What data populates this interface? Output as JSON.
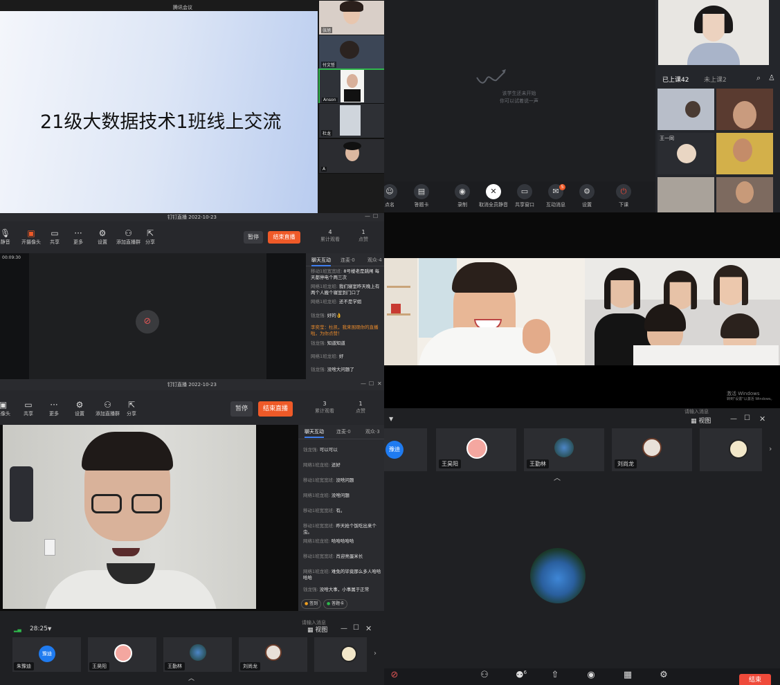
{
  "panel_a": {
    "meeting_label": "腾讯会议",
    "slide_title": "21级大数据技术1班线上交流",
    "thumbnails": [
      {
        "name": "张旭"
      },
      {
        "name": "付文哲"
      },
      {
        "name": "Anson"
      },
      {
        "name": "杜龙"
      },
      {
        "name": "A"
      }
    ]
  },
  "panel_b": {
    "empty_text_1": "该学生还未开始",
    "empty_text_2": "你可以试着说一声",
    "tabs": {
      "attended": "已上课42",
      "not_attended": "未上课2"
    },
    "student_names": [
      "王一同"
    ],
    "toolbar": [
      "点名",
      "答题卡",
      "录制",
      "取消全员静音",
      "共享窗口",
      "互动消息",
      "设置",
      "下课"
    ],
    "message_badge": "5"
  },
  "panel_c": {
    "title": "钉钉直播 2022-10-23",
    "tools": [
      "静音",
      "开摄像头",
      "共享",
      "更多",
      "设置",
      "添加直播群",
      "分享"
    ],
    "pause_label": "暂停",
    "end_label": "结束直播",
    "stats": [
      {
        "value": "4",
        "label": "累计观看"
      },
      {
        "value": "1",
        "label": "点赞"
      }
    ],
    "timer": "00:09:30",
    "chat_tabs": [
      "聊天互动",
      "连麦·0",
      "观众·4"
    ],
    "messages": [
      {
        "who": "移动1班宽宽班:",
        "text": "8号楼老是跳闸 每天都停电个两三次"
      },
      {
        "who": "网络1班龙班:",
        "text": "我们寝室昨天晚上有两个人搬个寝室到门口了"
      },
      {
        "who": "网络1班龙班:",
        "text": "还不是学姐"
      },
      {
        "who": "钱龙强:",
        "text": "好的👌"
      },
      {
        "who": "",
        "text": "李奕莹：杜凯，我来围观你的直播啦，为你点赞！",
        "sys": true
      },
      {
        "who": "钱龙强:",
        "text": "知道知道"
      },
      {
        "who": "网络1班龙班:",
        "text": "好"
      },
      {
        "who": "钱龙强:",
        "text": "没啥大问题了"
      }
    ]
  },
  "panel_d": {
    "title": "钉钉直播 2022-10-23",
    "tools": [
      "摄像头",
      "共享",
      "更多",
      "设置",
      "添加直播群",
      "分享"
    ],
    "pause_label": "暂停",
    "end_label": "结束直播",
    "stats": [
      {
        "value": "3",
        "label": "累计观看"
      },
      {
        "value": "1",
        "label": "点赞"
      }
    ],
    "chat_tabs": [
      "聊天互动",
      "连麦·0",
      "观众·3"
    ],
    "messages": [
      {
        "who": "钱龙强:",
        "text": "可以可以"
      },
      {
        "who": "网络1班龙班:",
        "text": "还好"
      },
      {
        "who": "移动1班宽宽班:",
        "text": "没啥问题"
      },
      {
        "who": "网络1班龙班:",
        "text": "没啥问题"
      },
      {
        "who": "移动1班宽宽班:",
        "text": "有。"
      },
      {
        "who": "移动1班宽宽班:",
        "text": "昨天抢个饭吃出来个虫。"
      },
      {
        "who": "网络1班龙班:",
        "text": "哈哈哈哈哈"
      },
      {
        "who": "移动1班宽宽班:",
        "text": "肖迎亮蛋米长"
      },
      {
        "who": "网络1班龙班:",
        "text": "难免的毕竟那么多人哈哈哈哈"
      },
      {
        "who": "钱龙强:",
        "text": "没啥大事，小事属于正常"
      }
    ],
    "actions": [
      "签到",
      "答题卡"
    ]
  },
  "panel_e": {
    "windows_activation_1": "激活 Windows",
    "windows_activation_2": "转到\"设置\"以激活 Windows。"
  },
  "panel_f": {
    "view_label": "视图",
    "hint": "请输入消息",
    "participants": [
      {
        "name": "豫迪"
      },
      {
        "name": "王昊阳"
      },
      {
        "name": "王勤林"
      },
      {
        "name": "刘尚龙"
      },
      {
        "name": ""
      }
    ],
    "bottom_badge": "6",
    "end_label": "结束"
  },
  "panel_g": {
    "timer": "28:25",
    "view_label": "视图",
    "hint": "请输入消息",
    "participants": [
      {
        "name": "朱豫迪",
        "avatar": "豫迪"
      },
      {
        "name": "王昊阳"
      },
      {
        "name": "王勤林"
      },
      {
        "name": "刘尚龙"
      },
      {
        "name": ""
      }
    ]
  },
  "colors": {
    "accent_orange": "#ef5a28",
    "accent_green": "#2fb94c",
    "accent_blue": "#3f7ff0"
  }
}
